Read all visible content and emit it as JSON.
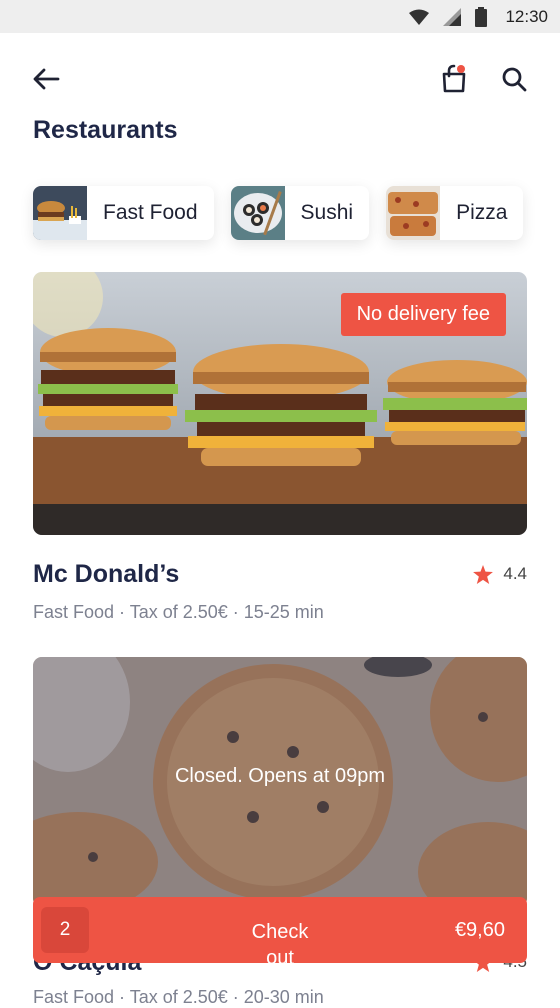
{
  "status_bar": {
    "time": "12:30"
  },
  "header": {
    "title": "Restaurants"
  },
  "categories": [
    {
      "label": "Fast Food"
    },
    {
      "label": "Sushi"
    },
    {
      "label": "Pizza"
    }
  ],
  "restaurants": [
    {
      "name": "Mc Donald’s",
      "meta": "Fast Food ·  Tax of 2.50€ · 15-25 min",
      "rating": "4.4",
      "badge": "No delivery fee"
    },
    {
      "name": "O Caçula",
      "meta": "Fast Food ·  Tax of 2.50€ · 20-30 min",
      "rating": "4.5",
      "overlay": "Closed. Opens at 09pm"
    }
  ],
  "checkout": {
    "count": "2",
    "label": "Check out",
    "price": "€9,60"
  },
  "colors": {
    "accent": "#ee5444",
    "title": "#1f2747",
    "muted": "#7d8190"
  },
  "icons": [
    "wifi-icon",
    "signal-icon",
    "battery-icon",
    "back-arrow-icon",
    "shopping-bag-icon",
    "search-icon",
    "star-icon"
  ]
}
